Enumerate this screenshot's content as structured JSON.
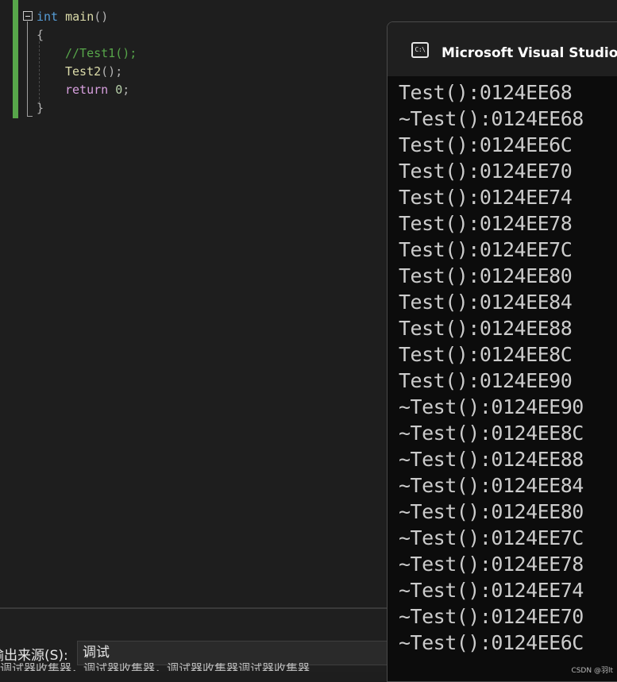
{
  "editor": {
    "lines": [
      {
        "tokens": [
          {
            "t": "int",
            "c": "kw-blue"
          },
          {
            "t": " ",
            "c": ""
          },
          {
            "t": "main",
            "c": "fn"
          },
          {
            "t": "()",
            "c": "punct"
          }
        ]
      },
      {
        "tokens": [
          {
            "t": "{",
            "c": "punct"
          }
        ]
      },
      {
        "tokens": [
          {
            "t": "//Test1();",
            "c": "comment"
          }
        ]
      },
      {
        "tokens": [
          {
            "t": "Test2",
            "c": "fn"
          },
          {
            "t": "();",
            "c": "punct"
          }
        ]
      },
      {
        "tokens": [
          {
            "t": "return",
            "c": "kw-purple"
          },
          {
            "t": " ",
            "c": ""
          },
          {
            "t": "0",
            "c": "num"
          },
          {
            "t": ";",
            "c": "punct"
          }
        ]
      },
      {
        "tokens": [
          {
            "t": "}",
            "c": "punct"
          }
        ]
      }
    ]
  },
  "console": {
    "title": "Microsoft Visual Studio 调试",
    "icon_text": "C:\\",
    "lines": [
      "Test():0124EE68",
      "~Test():0124EE68",
      "Test():0124EE6C",
      "Test():0124EE70",
      "Test():0124EE74",
      "Test():0124EE78",
      "Test():0124EE7C",
      "Test():0124EE80",
      "Test():0124EE84",
      "Test():0124EE88",
      "Test():0124EE8C",
      "Test():0124EE90",
      "~Test():0124EE90",
      "~Test():0124EE8C",
      "~Test():0124EE88",
      "~Test():0124EE84",
      "~Test():0124EE80",
      "~Test():0124EE7C",
      "~Test():0124EE78",
      "~Test():0124EE74",
      "~Test():0124EE70",
      "~Test():0124EE6C"
    ],
    "watermark": "CSDN @羽lt"
  },
  "output_panel": {
    "source_label": "输出来源(S):",
    "source_value": "调试",
    "partial_text": "调试器收集器，调试器收集器，调试器收集器调试器收集器"
  }
}
